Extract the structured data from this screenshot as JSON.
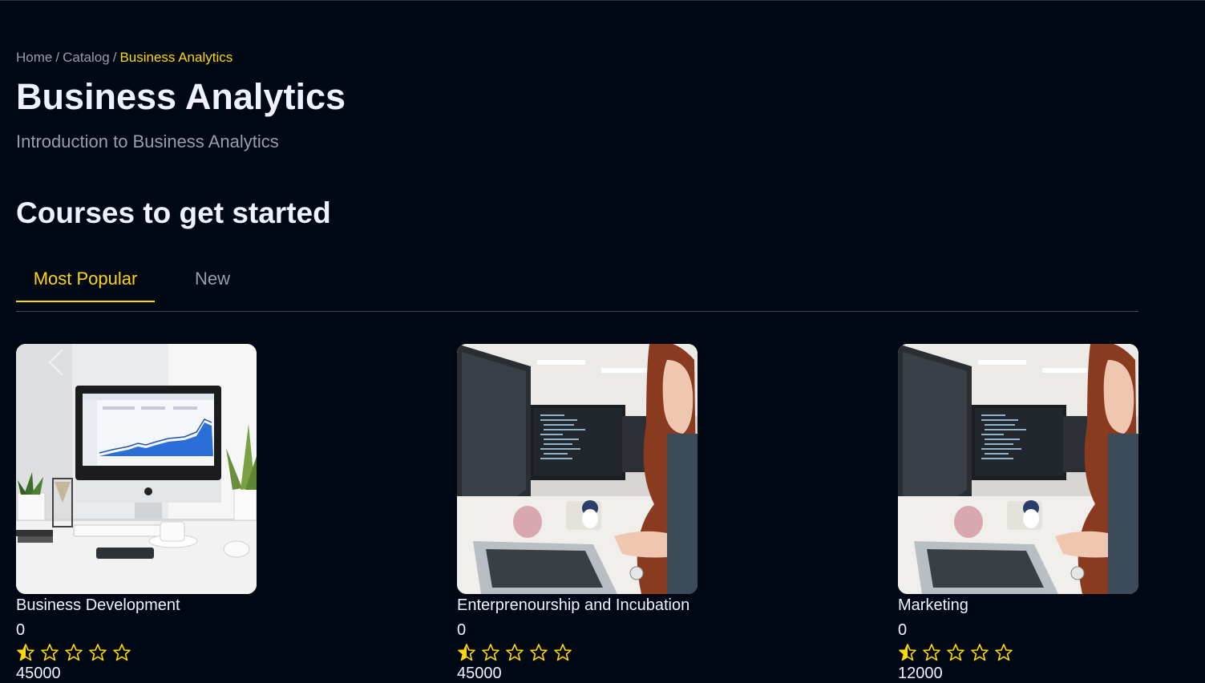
{
  "breadcrumb": {
    "home": "Home",
    "separator": "/",
    "catalog": "Catalog",
    "current": "Business Analytics"
  },
  "category": {
    "title": "Business Analytics",
    "description": "Introduction to Business Analytics"
  },
  "section": {
    "title": "Courses to get started",
    "tabs": [
      {
        "label": "Most Popular",
        "active": true
      },
      {
        "label": "New",
        "active": false
      }
    ]
  },
  "courses": [
    {
      "name": "Business Development",
      "rating": "0",
      "stars_filled": 0.5,
      "price": "45000",
      "image": "imac-analytics-desk-photo"
    },
    {
      "name": "Enterprenourship and Incubation",
      "rating": "0",
      "stars_filled": 0.5,
      "price": "45000",
      "image": "woman-at-computer-office-photo"
    },
    {
      "name": "Marketing",
      "rating": "0",
      "stars_filled": 0.5,
      "price": "12000",
      "image": "woman-at-computer-office-photo"
    }
  ],
  "colors": {
    "background": "#000814",
    "accent": "#ffd60a",
    "text": "#f1f2ff",
    "muted": "#999daa"
  },
  "icons": {
    "star": "star-icon",
    "half_star": "half-star-icon",
    "slider_prev": "chevron-left-icon"
  }
}
